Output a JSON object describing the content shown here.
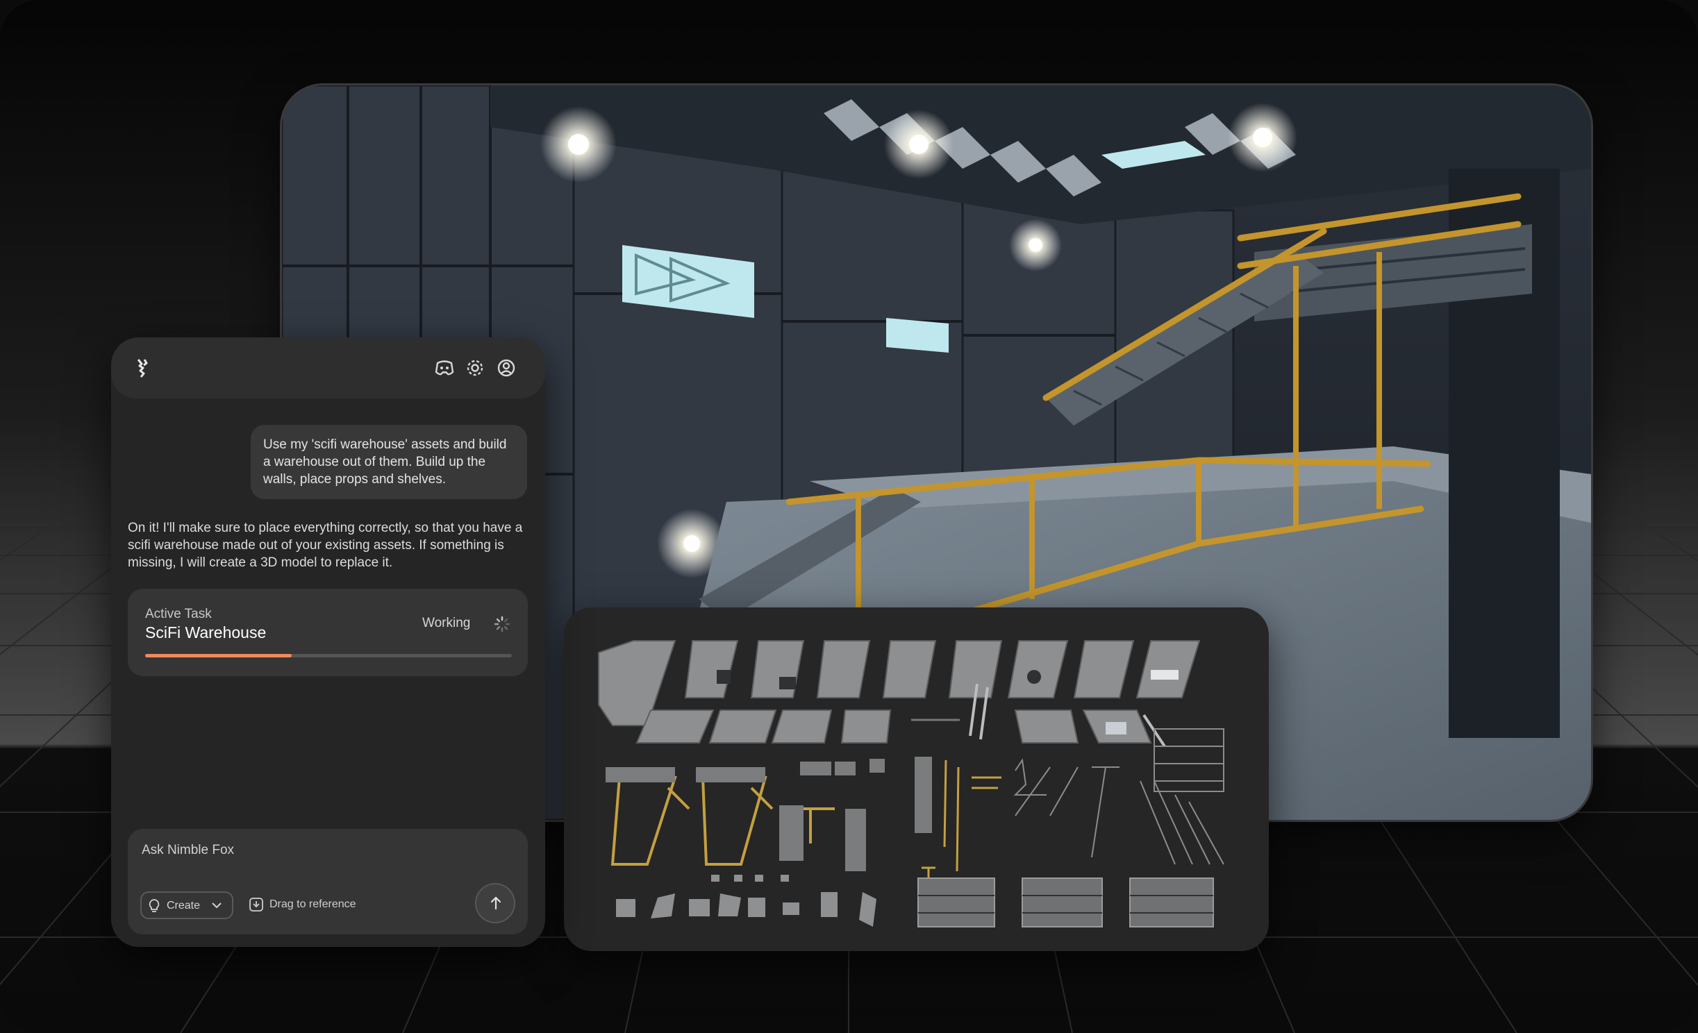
{
  "colors": {
    "accent": "#ef8a5b",
    "panel_bg": "#252525",
    "card_bg": "#353535",
    "railing": "#c4952c",
    "window_glow": "#bfe8ee"
  },
  "header": {
    "logo_icon": "fox-logo-icon",
    "icons": [
      "discord-icon",
      "gear-icon",
      "user-icon"
    ]
  },
  "chat": {
    "user_message": "Use my 'scifi warehouse' assets and build a warehouse out of them. Build up the walls, place props and shelves.",
    "assistant_message": "On it! I'll make sure to place everything correctly, so that you have a scifi warehouse made out of your existing assets. If something is missing, I will create a 3D model to replace it."
  },
  "task": {
    "label": "Active Task",
    "title": "SciFi Warehouse",
    "status": "Working",
    "progress": 0.4
  },
  "composer": {
    "placeholder": "Ask Nimble Fox",
    "mode": "Create",
    "attach_label": "Drag to reference",
    "send_icon": "arrow-up-icon"
  }
}
